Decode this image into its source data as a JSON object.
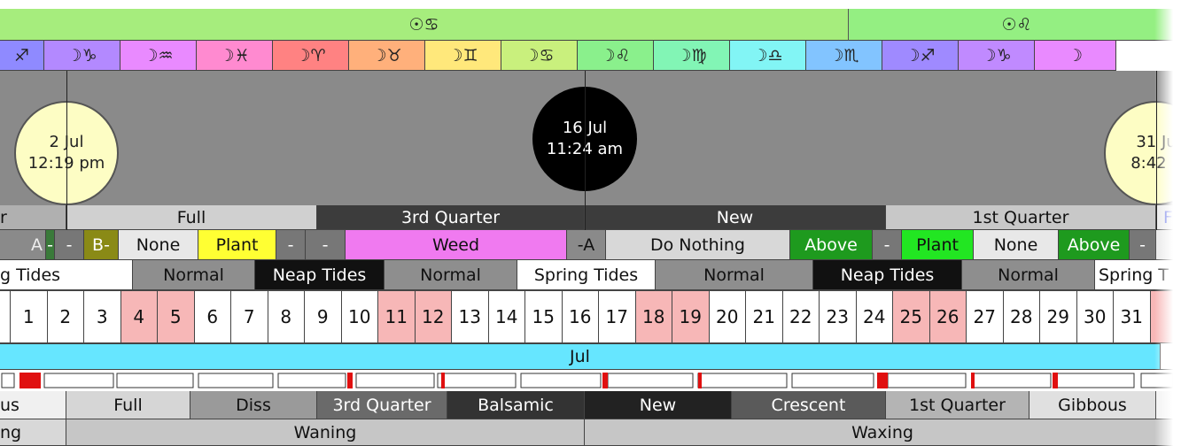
{
  "sun_row": [
    {
      "label": "☉♋",
      "color": "#a6ed7d"
    },
    {
      "label": "☉♌",
      "color": "#94ef82"
    }
  ],
  "moon_signs": [
    {
      "label": "♐",
      "color": "#8f8aff"
    },
    {
      "label": "☽♑",
      "color": "#b389ff"
    },
    {
      "label": "☽♒",
      "color": "#e98aff"
    },
    {
      "label": "☽♓",
      "color": "#ff8ad0"
    },
    {
      "label": "☽♈",
      "color": "#ff8282"
    },
    {
      "label": "☽♉",
      "color": "#ffb07b"
    },
    {
      "label": "☽♊",
      "color": "#ffe87b"
    },
    {
      "label": "☽♋",
      "color": "#c9f07d"
    },
    {
      "label": "☽♌",
      "color": "#8af08c"
    },
    {
      "label": "☽♍",
      "color": "#82f5b5"
    },
    {
      "label": "☽♎",
      "color": "#82f5f5"
    },
    {
      "label": "☽♏",
      "color": "#82c4ff"
    },
    {
      "label": "☽♐",
      "color": "#9f8aff"
    },
    {
      "label": "☽♑",
      "color": "#c08aff"
    },
    {
      "label": "☽",
      "color": "#e98aff"
    }
  ],
  "moon_events": [
    {
      "date": "2 Jul",
      "time": "12:19 pm",
      "kind": "full"
    },
    {
      "date": "16 Jul",
      "time": "11:24 am",
      "kind": "new"
    },
    {
      "date": "31 Ju",
      "time": "8:42 p",
      "kind": "full"
    }
  ],
  "phases": [
    {
      "label": "r",
      "bg": "#b0b0b0",
      "fg": "#111"
    },
    {
      "label": "Full",
      "bg": "#d0d0d0",
      "fg": "#111"
    },
    {
      "label": "3rd Quarter",
      "bg": "#3c3c3c",
      "fg": "#fff"
    },
    {
      "label": "New",
      "bg": "#3c3c3c",
      "fg": "#fff"
    },
    {
      "label": "1st Quarter",
      "bg": "#c8c8c8",
      "fg": "#111"
    },
    {
      "label": "F",
      "bg": "#e8e8e8",
      "fg": "#3344dd"
    }
  ],
  "activities": [
    {
      "label": "A",
      "bg": "#8a8a8a",
      "fg": "#eee"
    },
    {
      "label": "-",
      "bg": "#3a7a3a",
      "fg": "#fff"
    },
    {
      "label": "-",
      "bg": "#777",
      "fg": "#fff"
    },
    {
      "label": "B-",
      "bg": "#8a8a16",
      "fg": "#fff"
    },
    {
      "label": "None",
      "bg": "#e8e8e8",
      "fg": "#111"
    },
    {
      "label": "Plant",
      "bg": "#ffff33",
      "fg": "#111"
    },
    {
      "label": "-",
      "bg": "#777",
      "fg": "#fff"
    },
    {
      "label": "-",
      "bg": "#777",
      "fg": "#fff"
    },
    {
      "label": "Weed",
      "bg": "#f07af0",
      "fg": "#111"
    },
    {
      "label": "-A",
      "bg": "#8a8a8a",
      "fg": "#111"
    },
    {
      "label": "Do Nothing",
      "bg": "#d8d8d8",
      "fg": "#111"
    },
    {
      "label": "Above",
      "bg": "#1e9a1e",
      "fg": "#fff"
    },
    {
      "label": "-",
      "bg": "#777",
      "fg": "#fff"
    },
    {
      "label": "Plant",
      "bg": "#22e622",
      "fg": "#111"
    },
    {
      "label": "None",
      "bg": "#e8e8e8",
      "fg": "#111"
    },
    {
      "label": "Above",
      "bg": "#1e9a1e",
      "fg": "#fff"
    },
    {
      "label": "-",
      "bg": "#777",
      "fg": "#fff"
    },
    {
      "label": "",
      "bg": "#e8e8e8",
      "fg": "#111"
    }
  ],
  "tides": [
    {
      "label": "g Tides",
      "bg": "#ffffff",
      "fg": "#111"
    },
    {
      "label": "Normal",
      "bg": "#8e8e8e",
      "fg": "#111"
    },
    {
      "label": "Neap Tides",
      "bg": "#111111",
      "fg": "#fff"
    },
    {
      "label": "Normal",
      "bg": "#8e8e8e",
      "fg": "#111"
    },
    {
      "label": "Spring Tides",
      "bg": "#ffffff",
      "fg": "#111"
    },
    {
      "label": "Normal",
      "bg": "#8e8e8e",
      "fg": "#111"
    },
    {
      "label": "Neap Tides",
      "bg": "#111111",
      "fg": "#fff"
    },
    {
      "label": "Normal",
      "bg": "#8e8e8e",
      "fg": "#111"
    },
    {
      "label": "Spring T",
      "bg": "#ffffff",
      "fg": "#111"
    }
  ],
  "days": [
    {
      "day": "",
      "hl": false
    },
    {
      "day": "1",
      "hl": false
    },
    {
      "day": "2",
      "hl": false
    },
    {
      "day": "3",
      "hl": false
    },
    {
      "day": "4",
      "hl": true
    },
    {
      "day": "5",
      "hl": true
    },
    {
      "day": "6",
      "hl": false
    },
    {
      "day": "7",
      "hl": false
    },
    {
      "day": "8",
      "hl": false
    },
    {
      "day": "9",
      "hl": false
    },
    {
      "day": "10",
      "hl": false
    },
    {
      "day": "11",
      "hl": true
    },
    {
      "day": "12",
      "hl": true
    },
    {
      "day": "13",
      "hl": false
    },
    {
      "day": "14",
      "hl": false
    },
    {
      "day": "15",
      "hl": false
    },
    {
      "day": "16",
      "hl": false
    },
    {
      "day": "17",
      "hl": false
    },
    {
      "day": "18",
      "hl": true
    },
    {
      "day": "19",
      "hl": true
    },
    {
      "day": "20",
      "hl": false
    },
    {
      "day": "21",
      "hl": false
    },
    {
      "day": "22",
      "hl": false
    },
    {
      "day": "23",
      "hl": false
    },
    {
      "day": "24",
      "hl": false
    },
    {
      "day": "25",
      "hl": true
    },
    {
      "day": "26",
      "hl": true
    },
    {
      "day": "27",
      "hl": false
    },
    {
      "day": "28",
      "hl": false
    },
    {
      "day": "29",
      "hl": false
    },
    {
      "day": "30",
      "hl": false
    },
    {
      "day": "31",
      "hl": false
    },
    {
      "day": "",
      "hl": true
    }
  ],
  "month": {
    "label": "Jul",
    "color": "#66e6ff"
  },
  "highlight_color": "#f7b7b7",
  "marker_color": "#e01010",
  "lunation": [
    {
      "label": "us",
      "bg": "#f0f0f0",
      "fg": "#111"
    },
    {
      "label": "Full",
      "bg": "#d6d6d6",
      "fg": "#111"
    },
    {
      "label": "Diss",
      "bg": "#9a9a9a",
      "fg": "#111"
    },
    {
      "label": "3rd Quarter",
      "bg": "#6a6a6a",
      "fg": "#fff"
    },
    {
      "label": "Balsamic",
      "bg": "#333333",
      "fg": "#fff"
    },
    {
      "label": "New",
      "bg": "#222222",
      "fg": "#fff"
    },
    {
      "label": "Crescent",
      "bg": "#5a5a5a",
      "fg": "#fff"
    },
    {
      "label": "1st Quarter",
      "bg": "#b4b4b4",
      "fg": "#111"
    },
    {
      "label": "Gibbous",
      "bg": "#e0e0e0",
      "fg": "#111"
    },
    {
      "label": "",
      "bg": "#f2f2f2",
      "fg": "#111"
    }
  ],
  "waxwane": [
    {
      "label": "ng",
      "bg": "#d8d8d8",
      "fg": "#111"
    },
    {
      "label": "Waning",
      "bg": "#c6c6c6",
      "fg": "#111"
    },
    {
      "label": "Waxing",
      "bg": "#c6c6c6",
      "fg": "#111"
    }
  ]
}
